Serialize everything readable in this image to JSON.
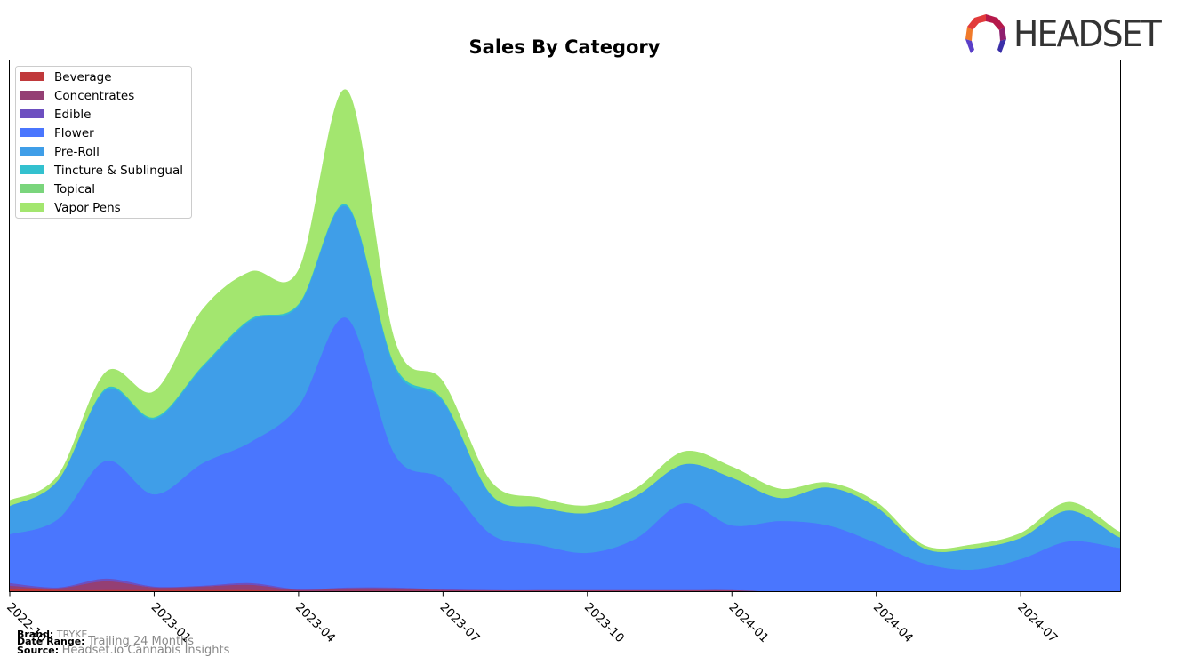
{
  "brand_logo": {
    "text": "HEADSET"
  },
  "footer": {
    "brand_label": "Brand:",
    "brand_value": "TRYKE",
    "date_range_label": "Date Range:",
    "date_range_value": "Trailing 24 Months",
    "source_label": "Source:",
    "source_value": "Headset.io Cannabis Insights"
  },
  "chart_data": {
    "type": "area",
    "stacked": true,
    "smooth": true,
    "title": "Sales By Category",
    "xlabel": "",
    "ylabel": "",
    "y_ticks_visible": false,
    "grid": false,
    "legend_position": "top-left",
    "x": [
      "2022-10",
      "2022-11",
      "2022-12",
      "2023-01",
      "2023-02",
      "2023-03",
      "2023-04",
      "2023-05",
      "2023-06",
      "2023-07",
      "2023-08",
      "2023-09",
      "2023-10",
      "2023-11",
      "2023-12",
      "2024-01",
      "2024-02",
      "2024-03",
      "2024-04",
      "2024-05",
      "2024-06",
      "2024-07",
      "2024-08",
      "2024-09"
    ],
    "x_tick_labels": [
      "2022-10",
      "2023-01",
      "2023-04",
      "2023-07",
      "2023-10",
      "2024-01",
      "2024-04",
      "2024-07"
    ],
    "ylim": [
      0,
      600
    ],
    "series": [
      {
        "name": "Beverage",
        "color": "#c0393b",
        "values": [
          4,
          2,
          2,
          2,
          2,
          2,
          1,
          1,
          1,
          1,
          1,
          1,
          1,
          1,
          1,
          1,
          0,
          0,
          0,
          0,
          0,
          0,
          0,
          0
        ]
      },
      {
        "name": "Concentrates",
        "color": "#943f74",
        "values": [
          3,
          2,
          10,
          3,
          4,
          6,
          1,
          3,
          3,
          1,
          1,
          1,
          1,
          1,
          1,
          1,
          0,
          0,
          0,
          0,
          0,
          0,
          0,
          0
        ]
      },
      {
        "name": "Edible",
        "color": "#6d4fc0",
        "values": [
          3,
          1,
          3,
          1,
          1,
          2,
          1,
          1,
          1,
          1,
          0,
          0,
          0,
          0,
          0,
          0,
          0,
          0,
          0,
          0,
          0,
          0,
          0,
          0
        ]
      },
      {
        "name": "Flower",
        "color": "#4a76fe",
        "values": [
          55,
          77,
          133,
          104,
          138,
          159,
          207,
          304,
          150,
          124,
          63,
          51,
          42,
          58,
          98,
          73,
          80,
          75,
          55,
          32,
          25,
          37,
          57,
          50
        ]
      },
      {
        "name": "Pre-Roll",
        "color": "#3f9ee8",
        "values": [
          32,
          44,
          80,
          85,
          108,
          137,
          113,
          126,
          98,
          88,
          44,
          43,
          45,
          48,
          44,
          54,
          26,
          43,
          41,
          17,
          24,
          24,
          35,
          13
        ]
      },
      {
        "name": "Tincture & Sublingual",
        "color": "#33c1cf",
        "values": [
          0,
          0,
          2,
          2,
          2,
          2,
          2,
          2,
          3,
          2,
          1,
          0,
          0,
          0,
          0,
          0,
          0,
          0,
          0,
          0,
          0,
          0,
          0,
          0
        ]
      },
      {
        "name": "Topical",
        "color": "#7ad57c",
        "values": [
          0,
          0,
          0,
          0,
          0,
          0,
          0,
          0,
          0,
          0,
          0,
          0,
          0,
          0,
          0,
          0,
          0,
          0,
          0,
          0,
          0,
          0,
          0,
          0
        ]
      },
      {
        "name": "Vapor Pens",
        "color": "#a3e66f",
        "values": [
          6,
          5,
          18,
          29,
          63,
          53,
          38,
          129,
          27,
          20,
          14,
          10,
          8,
          8,
          14,
          12,
          10,
          5,
          5,
          3,
          4,
          5,
          9,
          6
        ]
      }
    ]
  }
}
